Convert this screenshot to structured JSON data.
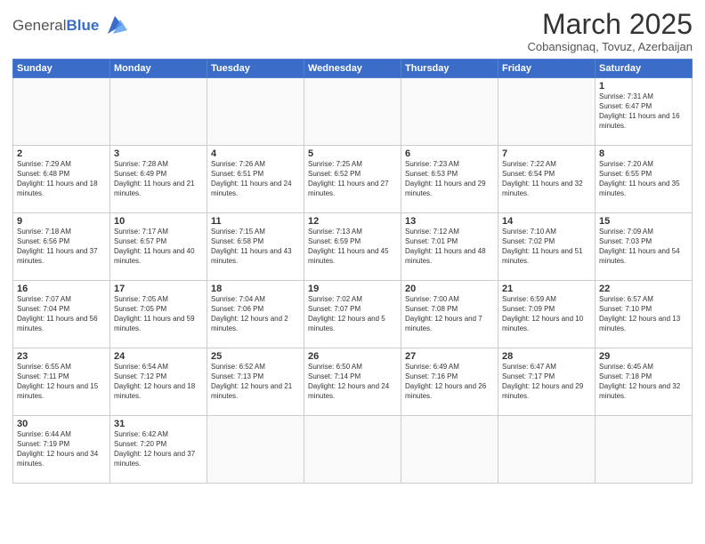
{
  "logo": {
    "text_general": "General",
    "text_blue": "Blue"
  },
  "header": {
    "month": "March 2025",
    "location": "Cobansignaq, Tovuz, Azerbaijan"
  },
  "weekdays": [
    "Sunday",
    "Monday",
    "Tuesday",
    "Wednesday",
    "Thursday",
    "Friday",
    "Saturday"
  ],
  "weeks": [
    [
      {
        "day": "",
        "info": ""
      },
      {
        "day": "",
        "info": ""
      },
      {
        "day": "",
        "info": ""
      },
      {
        "day": "",
        "info": ""
      },
      {
        "day": "",
        "info": ""
      },
      {
        "day": "",
        "info": ""
      },
      {
        "day": "1",
        "info": "Sunrise: 7:31 AM\nSunset: 6:47 PM\nDaylight: 11 hours and 16 minutes."
      }
    ],
    [
      {
        "day": "2",
        "info": "Sunrise: 7:29 AM\nSunset: 6:48 PM\nDaylight: 11 hours and 18 minutes."
      },
      {
        "day": "3",
        "info": "Sunrise: 7:28 AM\nSunset: 6:49 PM\nDaylight: 11 hours and 21 minutes."
      },
      {
        "day": "4",
        "info": "Sunrise: 7:26 AM\nSunset: 6:51 PM\nDaylight: 11 hours and 24 minutes."
      },
      {
        "day": "5",
        "info": "Sunrise: 7:25 AM\nSunset: 6:52 PM\nDaylight: 11 hours and 27 minutes."
      },
      {
        "day": "6",
        "info": "Sunrise: 7:23 AM\nSunset: 6:53 PM\nDaylight: 11 hours and 29 minutes."
      },
      {
        "day": "7",
        "info": "Sunrise: 7:22 AM\nSunset: 6:54 PM\nDaylight: 11 hours and 32 minutes."
      },
      {
        "day": "8",
        "info": "Sunrise: 7:20 AM\nSunset: 6:55 PM\nDaylight: 11 hours and 35 minutes."
      }
    ],
    [
      {
        "day": "9",
        "info": "Sunrise: 7:18 AM\nSunset: 6:56 PM\nDaylight: 11 hours and 37 minutes."
      },
      {
        "day": "10",
        "info": "Sunrise: 7:17 AM\nSunset: 6:57 PM\nDaylight: 11 hours and 40 minutes."
      },
      {
        "day": "11",
        "info": "Sunrise: 7:15 AM\nSunset: 6:58 PM\nDaylight: 11 hours and 43 minutes."
      },
      {
        "day": "12",
        "info": "Sunrise: 7:13 AM\nSunset: 6:59 PM\nDaylight: 11 hours and 45 minutes."
      },
      {
        "day": "13",
        "info": "Sunrise: 7:12 AM\nSunset: 7:01 PM\nDaylight: 11 hours and 48 minutes."
      },
      {
        "day": "14",
        "info": "Sunrise: 7:10 AM\nSunset: 7:02 PM\nDaylight: 11 hours and 51 minutes."
      },
      {
        "day": "15",
        "info": "Sunrise: 7:09 AM\nSunset: 7:03 PM\nDaylight: 11 hours and 54 minutes."
      }
    ],
    [
      {
        "day": "16",
        "info": "Sunrise: 7:07 AM\nSunset: 7:04 PM\nDaylight: 11 hours and 56 minutes."
      },
      {
        "day": "17",
        "info": "Sunrise: 7:05 AM\nSunset: 7:05 PM\nDaylight: 11 hours and 59 minutes."
      },
      {
        "day": "18",
        "info": "Sunrise: 7:04 AM\nSunset: 7:06 PM\nDaylight: 12 hours and 2 minutes."
      },
      {
        "day": "19",
        "info": "Sunrise: 7:02 AM\nSunset: 7:07 PM\nDaylight: 12 hours and 5 minutes."
      },
      {
        "day": "20",
        "info": "Sunrise: 7:00 AM\nSunset: 7:08 PM\nDaylight: 12 hours and 7 minutes."
      },
      {
        "day": "21",
        "info": "Sunrise: 6:59 AM\nSunset: 7:09 PM\nDaylight: 12 hours and 10 minutes."
      },
      {
        "day": "22",
        "info": "Sunrise: 6:57 AM\nSunset: 7:10 PM\nDaylight: 12 hours and 13 minutes."
      }
    ],
    [
      {
        "day": "23",
        "info": "Sunrise: 6:55 AM\nSunset: 7:11 PM\nDaylight: 12 hours and 15 minutes."
      },
      {
        "day": "24",
        "info": "Sunrise: 6:54 AM\nSunset: 7:12 PM\nDaylight: 12 hours and 18 minutes."
      },
      {
        "day": "25",
        "info": "Sunrise: 6:52 AM\nSunset: 7:13 PM\nDaylight: 12 hours and 21 minutes."
      },
      {
        "day": "26",
        "info": "Sunrise: 6:50 AM\nSunset: 7:14 PM\nDaylight: 12 hours and 24 minutes."
      },
      {
        "day": "27",
        "info": "Sunrise: 6:49 AM\nSunset: 7:16 PM\nDaylight: 12 hours and 26 minutes."
      },
      {
        "day": "28",
        "info": "Sunrise: 6:47 AM\nSunset: 7:17 PM\nDaylight: 12 hours and 29 minutes."
      },
      {
        "day": "29",
        "info": "Sunrise: 6:45 AM\nSunset: 7:18 PM\nDaylight: 12 hours and 32 minutes."
      }
    ],
    [
      {
        "day": "30",
        "info": "Sunrise: 6:44 AM\nSunset: 7:19 PM\nDaylight: 12 hours and 34 minutes."
      },
      {
        "day": "31",
        "info": "Sunrise: 6:42 AM\nSunset: 7:20 PM\nDaylight: 12 hours and 37 minutes."
      },
      {
        "day": "",
        "info": ""
      },
      {
        "day": "",
        "info": ""
      },
      {
        "day": "",
        "info": ""
      },
      {
        "day": "",
        "info": ""
      },
      {
        "day": "",
        "info": ""
      }
    ]
  ]
}
